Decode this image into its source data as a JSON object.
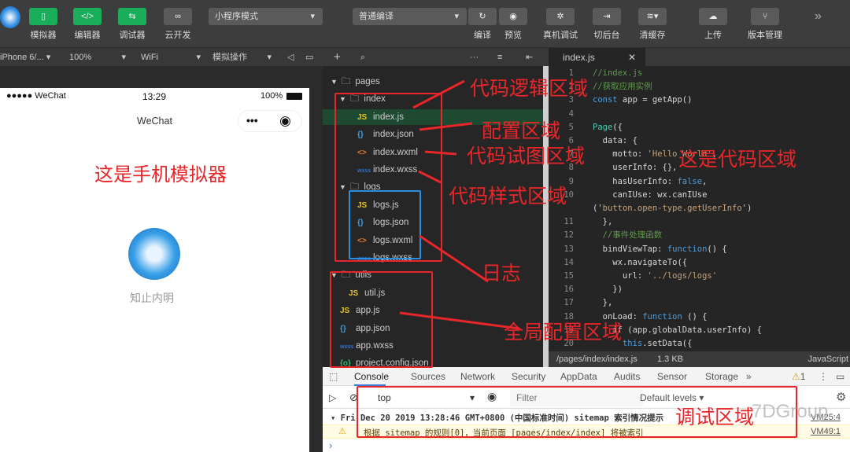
{
  "toolbar": {
    "buttons": [
      {
        "label": "模拟器",
        "icon": "phone-icon",
        "glyph": "▯"
      },
      {
        "label": "编辑器",
        "icon": "code-icon",
        "glyph": "</>"
      },
      {
        "label": "调试器",
        "icon": "debug-icon",
        "glyph": "⇆"
      },
      {
        "label": "云开发",
        "icon": "cloud-link-icon",
        "glyph": "∞"
      }
    ],
    "mode_select": "小程序模式",
    "compile_select": "普通编译",
    "actions": [
      {
        "label": "编译",
        "icon": "refresh-icon",
        "glyph": "↻"
      },
      {
        "label": "预览",
        "icon": "eye-icon",
        "glyph": "◉"
      },
      {
        "label": "真机调试",
        "icon": "bug-icon",
        "glyph": "✲"
      },
      {
        "label": "切后台",
        "icon": "switch-background-icon",
        "glyph": "⇥"
      },
      {
        "label": "清缓存",
        "icon": "layers-icon",
        "glyph": "≋▾"
      },
      {
        "label": "上传",
        "icon": "upload-cloud-icon",
        "glyph": "☁"
      },
      {
        "label": "版本管理",
        "icon": "git-branch-icon",
        "glyph": "⑂"
      }
    ],
    "more": "»"
  },
  "subbar": {
    "device": "iPhone 6/...",
    "zoom": "100%",
    "network": "WiFi",
    "operation": "模拟操作",
    "file_tab": "index.js"
  },
  "phone": {
    "carrier": "●●●●● WeChat",
    "time": "13:29",
    "battery": "100%",
    "nav_title": "WeChat",
    "nickname": "知止内明"
  },
  "tree": [
    {
      "name": "pages",
      "type": "folder",
      "depth": 0
    },
    {
      "name": "index",
      "type": "folder",
      "depth": 1
    },
    {
      "name": "index.js",
      "type": "js",
      "depth": 2,
      "selected": true
    },
    {
      "name": "index.json",
      "type": "json",
      "depth": 2
    },
    {
      "name": "index.wxml",
      "type": "wxml",
      "depth": 2
    },
    {
      "name": "index.wxss",
      "type": "wxss",
      "depth": 2
    },
    {
      "name": "logs",
      "type": "folder",
      "depth": 1
    },
    {
      "name": "logs.js",
      "type": "js",
      "depth": 2
    },
    {
      "name": "logs.json",
      "type": "json",
      "depth": 2
    },
    {
      "name": "logs.wxml",
      "type": "wxml",
      "depth": 2
    },
    {
      "name": "logs.wxss",
      "type": "wxss",
      "depth": 2
    },
    {
      "name": "utils",
      "type": "folder",
      "depth": 0
    },
    {
      "name": "util.js",
      "type": "js",
      "depth": 1
    },
    {
      "name": "app.js",
      "type": "js",
      "depth": 0
    },
    {
      "name": "app.json",
      "type": "json",
      "depth": 0
    },
    {
      "name": "app.wxss",
      "type": "wxss",
      "depth": 0
    },
    {
      "name": "project.config.json",
      "type": "config",
      "depth": 0
    }
  ],
  "code": [
    {
      "n": "1",
      "seg": [
        [
          "//index.js",
          "c"
        ]
      ]
    },
    {
      "n": "2",
      "seg": [
        [
          "//获取应用实例",
          "c"
        ]
      ]
    },
    {
      "n": "3",
      "seg": [
        [
          "const",
          "k"
        ],
        [
          " app = getApp()",
          ""
        ]
      ]
    },
    {
      "n": "4",
      "seg": []
    },
    {
      "n": "5",
      "seg": [
        [
          "Page",
          "gr"
        ],
        [
          "({",
          ""
        ]
      ]
    },
    {
      "n": "6",
      "seg": [
        [
          "  data: {",
          ""
        ]
      ]
    },
    {
      "n": "7",
      "seg": [
        [
          "    motto: ",
          ""
        ],
        [
          "'Hello World'",
          "s"
        ],
        [
          ",",
          ""
        ]
      ]
    },
    {
      "n": "8",
      "seg": [
        [
          "    userInfo: {},",
          ""
        ]
      ]
    },
    {
      "n": "9",
      "seg": [
        [
          "    hasUserInfo: ",
          ""
        ],
        [
          "false",
          "k"
        ],
        [
          ",",
          ""
        ]
      ]
    },
    {
      "n": "10",
      "seg": [
        [
          "    canIUse: wx.canIUse",
          ""
        ]
      ]
    },
    {
      "n": "",
      "seg": [
        [
          "('",
          ""
        ],
        [
          "button.open-type.getUserInfo",
          "s"
        ],
        [
          "')",
          ""
        ]
      ],
      "wrap": true
    },
    {
      "n": "11",
      "seg": [
        [
          "  },",
          ""
        ]
      ]
    },
    {
      "n": "12",
      "seg": [
        [
          "  //事件处理函数",
          "c"
        ]
      ]
    },
    {
      "n": "13",
      "seg": [
        [
          "  bindViewTap: ",
          ""
        ],
        [
          "function",
          "k"
        ],
        [
          "() {",
          ""
        ]
      ]
    },
    {
      "n": "14",
      "seg": [
        [
          "    wx.navigateTo({",
          ""
        ]
      ]
    },
    {
      "n": "15",
      "seg": [
        [
          "      url: ",
          ""
        ],
        [
          "'../logs/logs'",
          "s"
        ]
      ]
    },
    {
      "n": "16",
      "seg": [
        [
          "    })",
          ""
        ]
      ]
    },
    {
      "n": "17",
      "seg": [
        [
          "  },",
          ""
        ]
      ]
    },
    {
      "n": "18",
      "seg": [
        [
          "  onLoad: ",
          ""
        ],
        [
          "function",
          "k"
        ],
        [
          " () {",
          ""
        ]
      ]
    },
    {
      "n": "19",
      "seg": [
        [
          "    if (app.globalData.userInfo) {",
          ""
        ]
      ]
    },
    {
      "n": "20",
      "seg": [
        [
          "      ",
          ""
        ],
        [
          "this",
          "k"
        ],
        [
          ".setData({",
          ""
        ]
      ]
    }
  ],
  "status": {
    "path": "/pages/index/index.js",
    "size": "1.3 KB",
    "lang": "JavaScript"
  },
  "devtools": {
    "tabs": [
      "Console",
      "Sources",
      "Network",
      "Security",
      "AppData",
      "Audits",
      "Sensor",
      "Storage",
      "»"
    ],
    "active_tab": "Console",
    "warn_count": "1",
    "context": "top",
    "filter_placeholder": "Filter",
    "levels": "Default levels ▾",
    "log1": "Fri Dec 20 2019 13:28:46 GMT+0800 (中国标准时间) sitemap 索引情况提示",
    "log1_src": "VM25:4",
    "log2": "根据 sitemap 的规则[0]，当前页面 [pages/index/index] 将被索引",
    "log2_src": "VM49:1",
    "prompt": "›"
  },
  "annotations": {
    "simulator": "这是手机模拟器",
    "logic": "代码逻辑区域",
    "config": "配置区域",
    "view": "代码试图区域",
    "style": "代码样式区域",
    "code": "这是代码区域",
    "logs": "日志",
    "global": "全局配置区域",
    "debug": "调试区域"
  },
  "watermark": "7DGroup",
  "colors": {
    "accent_green": "#1aad5a",
    "annotation_red": "#e8262a",
    "annotation_blue": "#2b8fe0"
  }
}
